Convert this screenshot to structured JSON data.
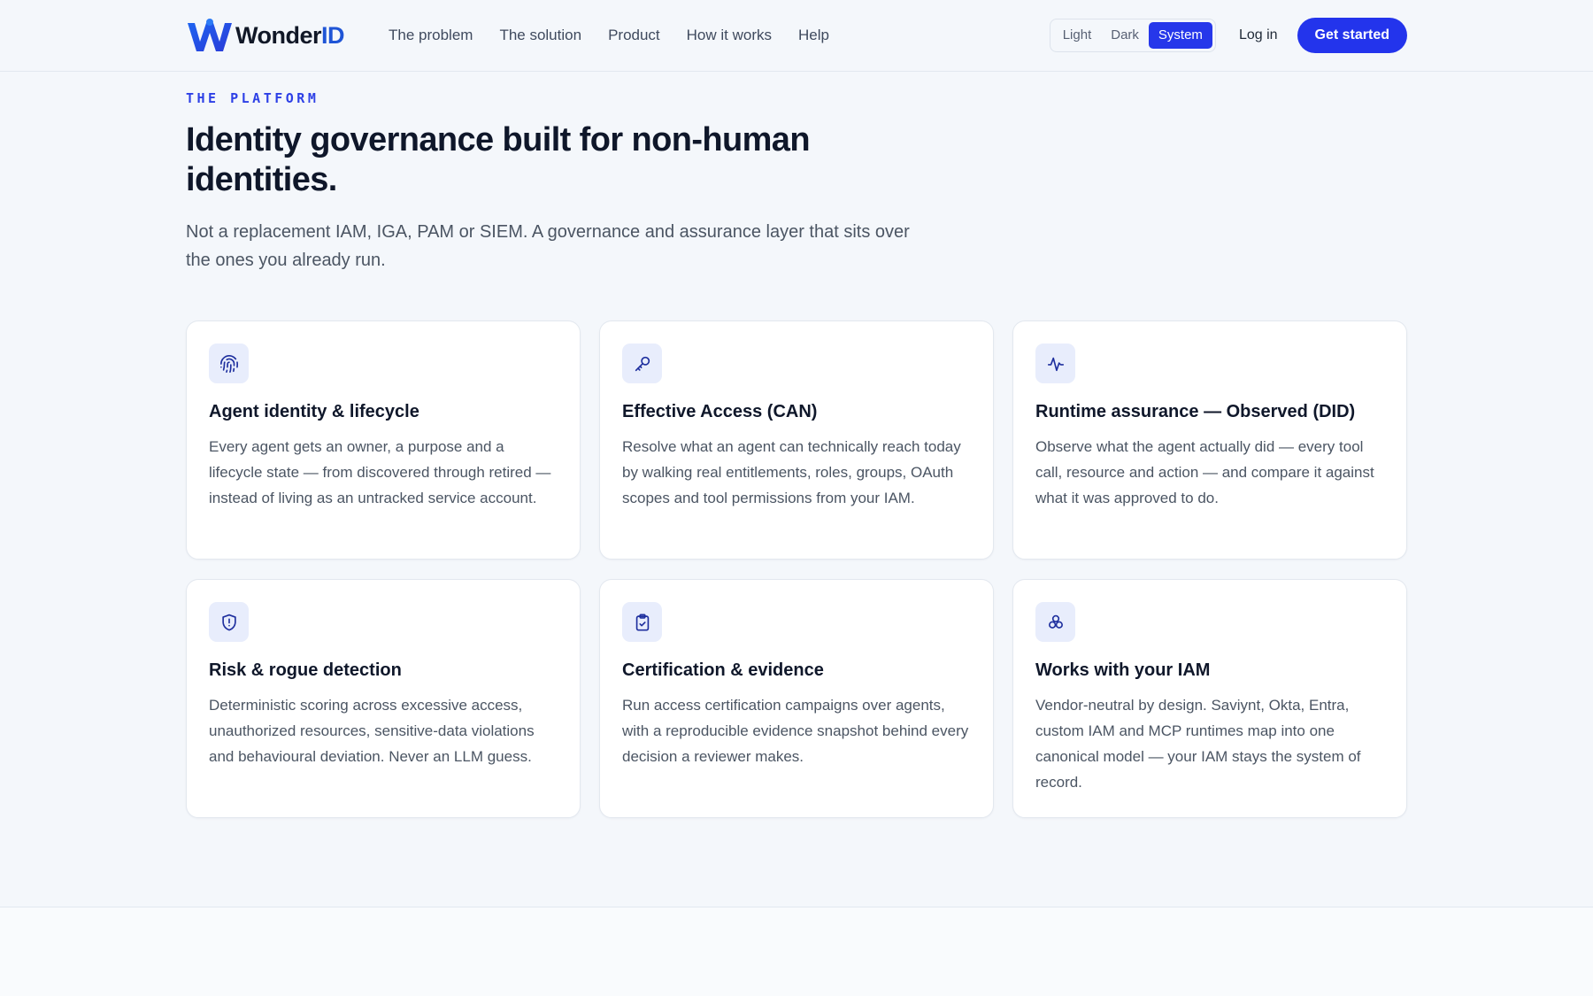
{
  "brand": {
    "name_main": "Wonder",
    "name_accent": "ID",
    "colors": {
      "primary": "#2334ec",
      "accent": "#1f55d6"
    }
  },
  "nav": {
    "items": [
      "The problem",
      "The solution",
      "Product",
      "How it works",
      "Help"
    ]
  },
  "theme": {
    "options": [
      "Light",
      "Dark",
      "System"
    ],
    "selected": "System"
  },
  "header_actions": {
    "login": "Log in",
    "cta": "Get started"
  },
  "hero": {
    "eyebrow": "THE PLATFORM",
    "title": "Identity governance built for non-human identities.",
    "subtitle": "Not a replacement IAM, IGA, PAM or SIEM. A governance and assurance layer that sits over the ones you already run."
  },
  "cards": [
    {
      "icon": "fingerprint-icon",
      "title": "Agent identity & lifecycle",
      "desc": "Every agent gets an owner, a purpose and a lifecycle state — from discovered through retired — instead of living as an untracked service account."
    },
    {
      "icon": "key-icon",
      "title": "Effective Access (CAN)",
      "desc": "Resolve what an agent can technically reach today by walking real entitlements, roles, groups, OAuth scopes and tool permissions from your IAM."
    },
    {
      "icon": "activity-icon",
      "title": "Runtime assurance — Observed (DID)",
      "desc": "Observe what the agent actually did — every tool call, resource and action — and compare it against what it was approved to do."
    },
    {
      "icon": "shield-alert-icon",
      "title": "Risk & rogue detection",
      "desc": "Deterministic scoring across excessive access, unauthorized resources, sensitive-data violations and behavioural deviation. Never an LLM guess."
    },
    {
      "icon": "clipboard-check-icon",
      "title": "Certification & evidence",
      "desc": "Run access certification campaigns over agents, with a reproducible evidence snapshot behind every decision a reviewer makes."
    },
    {
      "icon": "boxes-icon",
      "title": "Works with your IAM",
      "desc": "Vendor-neutral by design. Saviynt, Okta, Entra, custom IAM and MCP runtimes map into one canonical model — your IAM stays the system of record."
    }
  ]
}
